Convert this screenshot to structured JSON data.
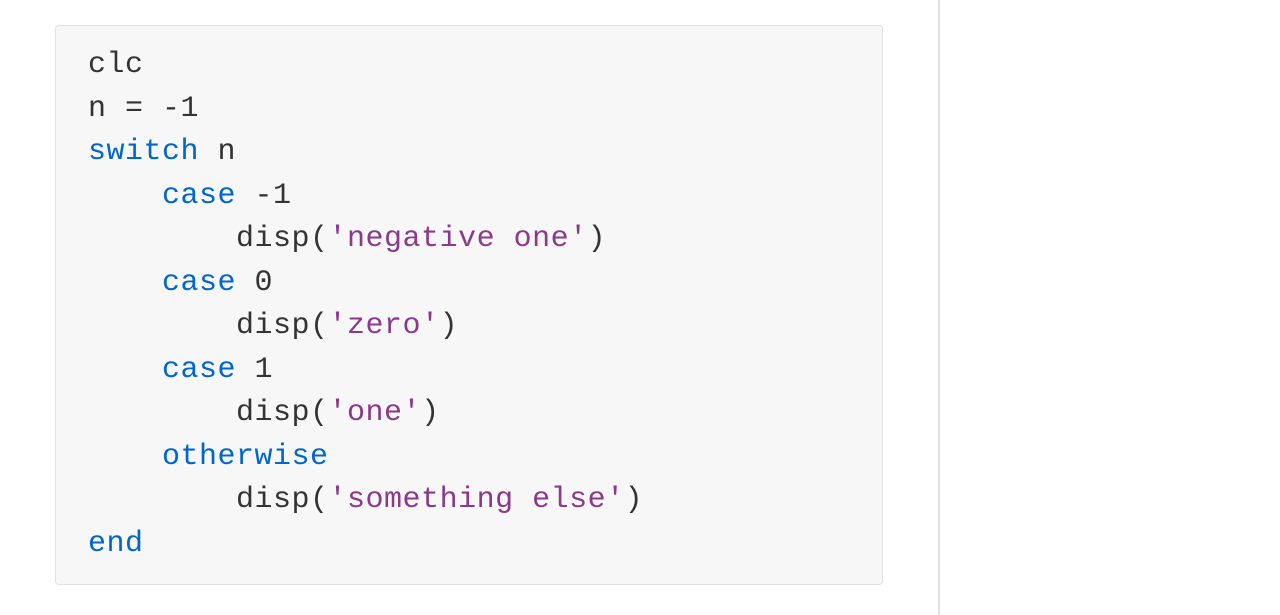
{
  "code": {
    "lines": [
      {
        "indent": 0,
        "tokens": [
          {
            "t": "clc",
            "c": "normal"
          }
        ]
      },
      {
        "indent": 0,
        "tokens": [
          {
            "t": "n = -1",
            "c": "normal"
          }
        ]
      },
      {
        "indent": 0,
        "tokens": [
          {
            "t": "switch",
            "c": "keyword"
          },
          {
            "t": " n",
            "c": "normal"
          }
        ]
      },
      {
        "indent": 1,
        "tokens": [
          {
            "t": "case",
            "c": "keyword"
          },
          {
            "t": " -1",
            "c": "normal"
          }
        ]
      },
      {
        "indent": 2,
        "tokens": [
          {
            "t": "disp(",
            "c": "normal"
          },
          {
            "t": "'negative one'",
            "c": "string"
          },
          {
            "t": ")",
            "c": "normal"
          }
        ]
      },
      {
        "indent": 1,
        "tokens": [
          {
            "t": "case",
            "c": "keyword"
          },
          {
            "t": " 0",
            "c": "normal"
          }
        ]
      },
      {
        "indent": 2,
        "tokens": [
          {
            "t": "disp(",
            "c": "normal"
          },
          {
            "t": "'zero'",
            "c": "string"
          },
          {
            "t": ")",
            "c": "normal"
          }
        ]
      },
      {
        "indent": 1,
        "tokens": [
          {
            "t": "case",
            "c": "keyword"
          },
          {
            "t": " 1",
            "c": "normal"
          }
        ]
      },
      {
        "indent": 2,
        "tokens": [
          {
            "t": "disp(",
            "c": "normal"
          },
          {
            "t": "'one'",
            "c": "string"
          },
          {
            "t": ")",
            "c": "normal"
          }
        ]
      },
      {
        "indent": 1,
        "tokens": [
          {
            "t": "otherwise",
            "c": "keyword"
          }
        ]
      },
      {
        "indent": 2,
        "tokens": [
          {
            "t": "disp(",
            "c": "normal"
          },
          {
            "t": "'something else'",
            "c": "string"
          },
          {
            "t": ")",
            "c": "normal"
          }
        ]
      },
      {
        "indent": 0,
        "tokens": [
          {
            "t": "end",
            "c": "keyword"
          }
        ]
      }
    ],
    "indent_unit": "    "
  }
}
